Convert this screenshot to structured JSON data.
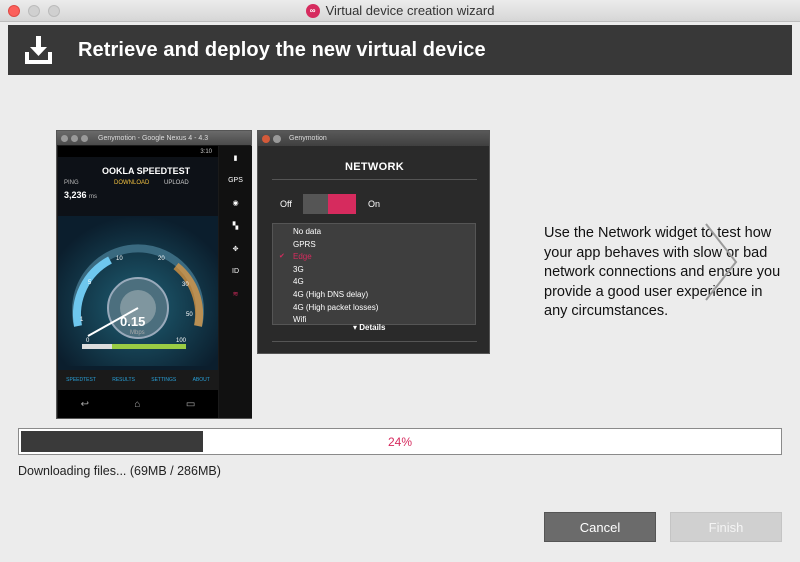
{
  "window": {
    "title": "Virtual device creation wizard",
    "logo_glyph": "∞"
  },
  "header": {
    "title": "Retrieve and deploy the new virtual device"
  },
  "phone_window": {
    "title": "Genymotion - Google Nexus 4 - 4.3",
    "status_time": "3:10",
    "app_name": "OOKLA SPEEDTEST",
    "ping_label": "PING",
    "ping_value": "3,236",
    "ping_unit": "ms",
    "download_label": "DOWNLOAD",
    "upload_label": "UPLOAD",
    "speed_value": "0.15",
    "speed_unit": "Mbps",
    "gauge_ticks": [
      "0",
      "1",
      "5",
      "10",
      "20",
      "30",
      "50",
      "100"
    ],
    "tabs": [
      "SPEEDTEST",
      "RESULTS",
      "SETTINGS",
      "ABOUT"
    ],
    "side_tools": [
      "battery",
      "GPS",
      "camera",
      "clapper",
      "move",
      "ID",
      "network"
    ]
  },
  "network_window": {
    "title": "Genymotion",
    "heading": "NETWORK",
    "off_label": "Off",
    "on_label": "On",
    "options": [
      "No data",
      "GPRS",
      "Edge",
      "3G",
      "4G",
      "4G (High DNS delay)",
      "4G (High packet losses)",
      "Wifi"
    ],
    "selected": "Edge",
    "details_label": "▾ Details"
  },
  "description": "Use the Network widget to test how your app behaves with slow or bad network connections and ensure you provide a good user experience in any circumstances.",
  "progress": {
    "percent": 24,
    "label": "24%",
    "status_text": "Downloading files... (69MB / 286MB)"
  },
  "buttons": {
    "cancel": "Cancel",
    "finish": "Finish"
  },
  "colors": {
    "accent": "#d62b5e",
    "header_bg": "#383838",
    "progress_fill": "#3a3a3a"
  }
}
